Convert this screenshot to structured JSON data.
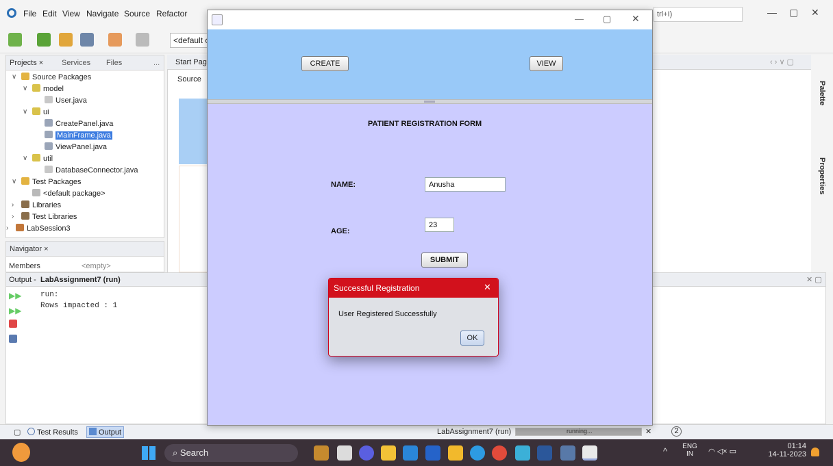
{
  "ide": {
    "menus": [
      "File",
      "Edit",
      "View",
      "Navigate",
      "Source",
      "Refactor"
    ],
    "config_combo": "<default c",
    "search_hint": "trl+I)",
    "projects_tabs": [
      "Projects ×",
      "Services",
      "Files",
      "..."
    ],
    "tree": [
      {
        "label": "Source Packages"
      },
      {
        "label": "model"
      },
      {
        "label": "User.java"
      },
      {
        "label": "ui"
      },
      {
        "label": "CreatePanel.java"
      },
      {
        "label": "MainFrame.java"
      },
      {
        "label": "ViewPanel.java"
      },
      {
        "label": "util"
      },
      {
        "label": "DatabaseConnector.java"
      },
      {
        "label": "Test Packages"
      },
      {
        "label": "<default package>"
      },
      {
        "label": "Libraries"
      },
      {
        "label": "Test Libraries"
      },
      {
        "label": "LabSession3"
      }
    ],
    "navigator_tab": "Navigator ×",
    "navigator_members": "Members",
    "navigator_empty": "<empty>",
    "editor_tab": "Start Pag",
    "editor_source": "Source",
    "palette_label": "Palette",
    "properties_label": "Properties",
    "output_title_prefix": "Output - ",
    "output_title": "LabAssignment7 (run)",
    "output_lines": [
      "run:",
      "Rows impacted : 1"
    ],
    "status_tabs": [
      "Test Results",
      "Output"
    ],
    "status_project": "LabAssignment7 (run)",
    "status_running": "running...",
    "status_count": "2"
  },
  "frame": {
    "create_button": "CREATE",
    "view_button": "VIEW",
    "form_title": "PATIENT REGISTRATION FORM",
    "name_label": "NAME:",
    "name_value": "Anusha",
    "age_label": "AGE:",
    "age_value": "23",
    "submit_button": "SUBMIT"
  },
  "dialog": {
    "title": "Successful Registration",
    "message": "User Registered Successfully",
    "ok_button": "OK"
  },
  "taskbar": {
    "search": "Search",
    "lang": "ENG",
    "lang_sub": "IN",
    "time": "01:14",
    "date": "14-11-2023"
  }
}
